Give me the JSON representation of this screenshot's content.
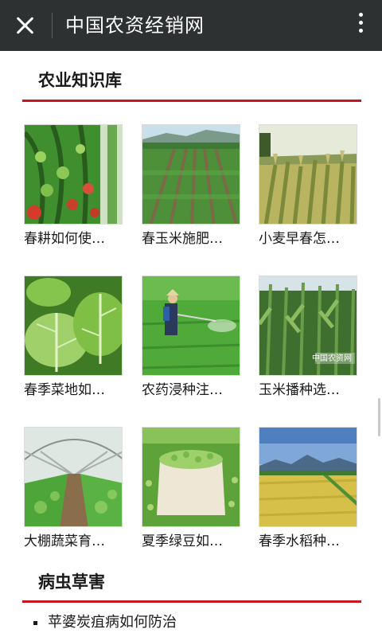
{
  "topbar": {
    "title": "中国农资经销网",
    "close_icon": "close-icon",
    "more_icon": "more-vertical-icon",
    "background": "#2e3132"
  },
  "knowledge": {
    "title": "农业知识库",
    "accent": "#c8141e",
    "cards": [
      {
        "label": "春耕如何使…",
        "image": "tomato-vines"
      },
      {
        "label": "春玉米施肥…",
        "image": "corn-seedling-field"
      },
      {
        "label": "小麦早春怎…",
        "image": "wheat-field"
      },
      {
        "label": "春季菜地如…",
        "image": "green-vegetable-leaves"
      },
      {
        "label": "农药浸种注…",
        "image": "farmer-spraying-pesticide"
      },
      {
        "label": "玉米播种选…",
        "image": "tall-corn-plants"
      },
      {
        "label": "大棚蔬菜育…",
        "image": "greenhouse-vegetables"
      },
      {
        "label": "夏季绿豆如…",
        "image": "green-beans-in-bowl"
      },
      {
        "label": "春季水稻种…",
        "image": "golden-rice-field"
      }
    ],
    "watermark": "中国农资网"
  },
  "pests": {
    "title": "病虫草害",
    "items": [
      "苹婆炭疽病如何防治"
    ]
  }
}
